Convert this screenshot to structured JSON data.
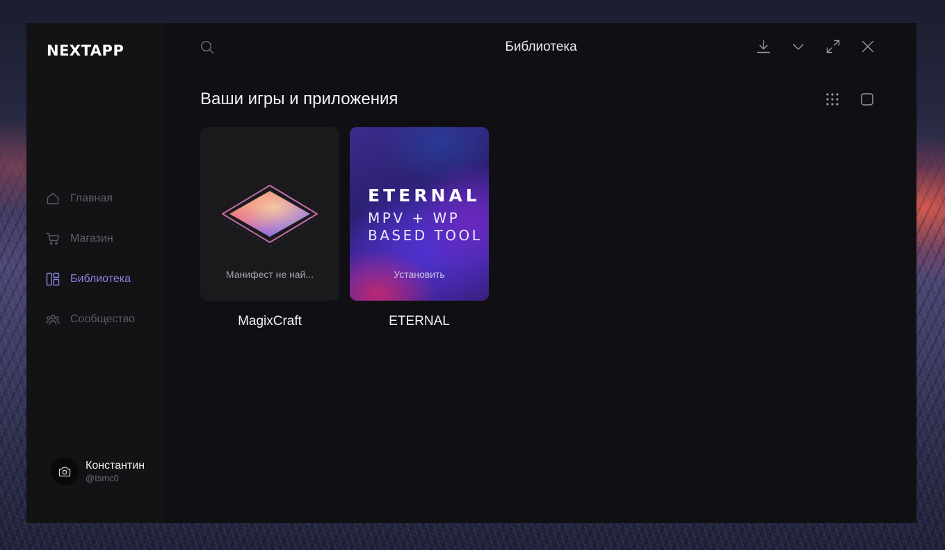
{
  "app": {
    "logo_text": "NEXTAPP",
    "window_title": "Библиотека"
  },
  "sidebar": {
    "items": [
      {
        "label": "Главная",
        "icon": "home-icon",
        "active": false
      },
      {
        "label": "Магазин",
        "icon": "cart-icon",
        "active": false
      },
      {
        "label": "Библиотека",
        "icon": "library-icon",
        "active": true
      },
      {
        "label": "Сообщество",
        "icon": "community-icon",
        "active": false
      }
    ]
  },
  "user": {
    "name": "Константин",
    "handle": "@tsmc0",
    "avatar_icon": "camera-icon"
  },
  "toolbar": {
    "icons": [
      "search-icon",
      "download-icon",
      "chevron-down-icon",
      "expand-icon",
      "close-icon"
    ]
  },
  "library": {
    "section_title": "Ваши игры и приложения",
    "view_icons": [
      "grid-view-icon",
      "single-view-icon"
    ],
    "items": [
      {
        "name": "MagixCraft",
        "status": "Манифест не най..."
      },
      {
        "name": "ETERNAL",
        "status": "Установить",
        "art_title": "ETERNAL",
        "art_subtitle": "MPV + WP\nBASED TOOL"
      }
    ]
  },
  "colors": {
    "accent": "#8a84e0",
    "window_bg": "#101014",
    "sidebar_bg": "#131316"
  }
}
